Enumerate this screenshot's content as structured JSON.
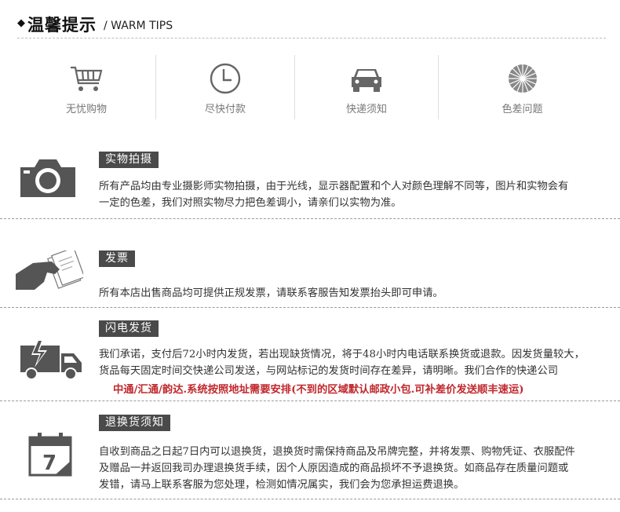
{
  "header": {
    "title_cn": "温馨提示",
    "title_en": "/ WARM TIPS"
  },
  "tips": [
    {
      "label": "无忧购物",
      "icon": "shopping-cart-icon"
    },
    {
      "label": "尽快付款",
      "icon": "clock-icon"
    },
    {
      "label": "快递须知",
      "icon": "car-icon"
    },
    {
      "label": "色差问题",
      "icon": "color-wheel-icon"
    }
  ],
  "sections": {
    "photo": {
      "tag": "实物拍摄",
      "line1": "所有产品均由专业摄影师实物拍摄，由于光线，显示器配置和个人对颜色理解不同等，图片和实物会有",
      "line2": "一定的色差，我们对照实物尽力把色差调小，请亲们以实物为准。"
    },
    "invoice": {
      "tag": "发票",
      "line1": "所有本店出售商品均可提供正规发票，请联系客服告知发票抬头即可申请。"
    },
    "shipping": {
      "tag": "闪电发货",
      "line1": "我们承诺，支付后72小时内发货，若出现缺货情况，将于48小时内电话联系换货或退款。因发货量较大，",
      "line2": "货品每天固定时间交快递公司发送，与网站标记的发货时间存在差异，请明晰。我们合作的快递公司",
      "red": "中通/汇通/韵达.系统按照地址需要安排(不到的区域默认邮政小包.可补差价发送顺丰速运)"
    },
    "returns": {
      "tag": "退换货须知",
      "calendar_number": "7",
      "line1": "自收到商品之日起7日内可以退换货，退换货时需保持商品及吊牌完整，并将发票、购物凭证、衣服配件",
      "line2": "及赠品一并返回我司办理退换货手续，因个人原因造成的商品损坏不予退换货。如商品存在质量问题或",
      "line3": "发错，请马上联系客服为您处理，检测如情况属实，我们会为您承担运费退换。"
    }
  }
}
